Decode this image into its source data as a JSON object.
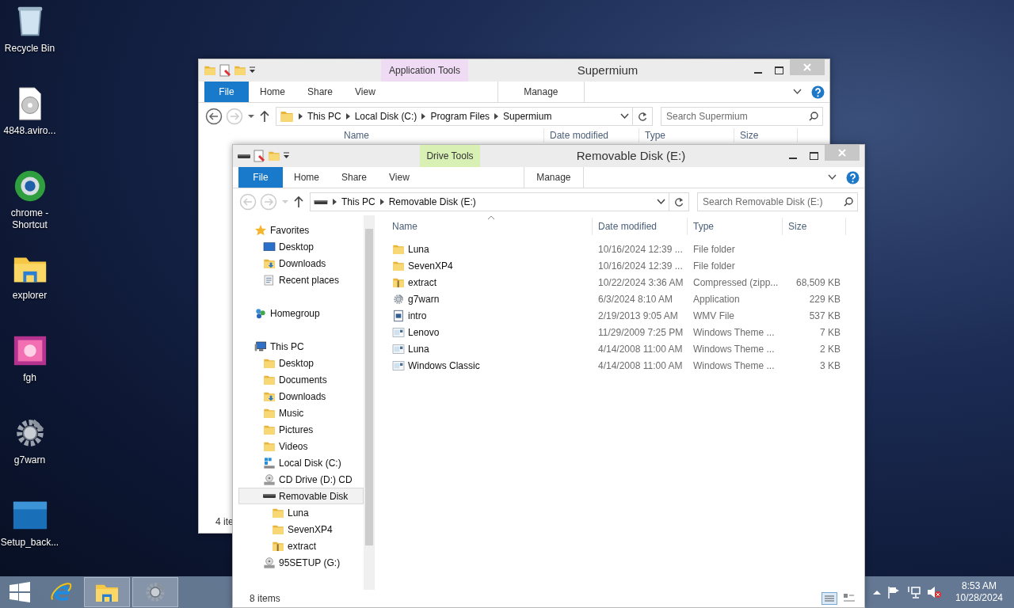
{
  "desktop_icons": [
    {
      "label": "Recycle Bin",
      "kind": "trash"
    },
    {
      "label": "4848.aviro...",
      "kind": "disc"
    },
    {
      "label": "chrome - Shortcut",
      "kind": "globe"
    },
    {
      "label": "explorer",
      "kind": "explorer"
    },
    {
      "label": "fgh",
      "kind": "picture"
    },
    {
      "label": "g7warn",
      "kind": "gear"
    },
    {
      "label": "Setup_back...",
      "kind": "tile"
    }
  ],
  "back_window": {
    "title": "Supermium",
    "context_group": {
      "label": "Application Tools",
      "color": "#efdcf4"
    },
    "ribbon_tabs": [
      {
        "label": "File",
        "kind": "file"
      },
      {
        "label": "Home",
        "kind": "tab"
      },
      {
        "label": "Share",
        "kind": "tab"
      },
      {
        "label": "View",
        "kind": "tab"
      },
      {
        "label": "Manage",
        "kind": "context"
      }
    ],
    "address_icon": {
      "kind": "folder"
    },
    "breadcrumb": [
      "This PC",
      "Local Disk (C:)",
      "Program Files",
      "Supermium"
    ],
    "search": {
      "placeholder": "Search Supermium"
    },
    "columns": [
      "Name",
      "Date modified",
      "Type",
      "Size"
    ],
    "status_text": "4 ite"
  },
  "front_window": {
    "title": "Removable Disk (E:)",
    "context_group": {
      "label": "Drive Tools",
      "color": "#d8f0b4"
    },
    "ribbon_tabs": [
      {
        "label": "File",
        "kind": "file"
      },
      {
        "label": "Home",
        "kind": "tab"
      },
      {
        "label": "Share",
        "kind": "tab"
      },
      {
        "label": "View",
        "kind": "tab"
      },
      {
        "label": "Manage",
        "kind": "context"
      }
    ],
    "address_icon": {
      "kind": "usb"
    },
    "breadcrumb": [
      "This PC",
      "Removable Disk (E:)"
    ],
    "search": {
      "placeholder": "Search Removable Disk (E:)"
    },
    "nav_tree": [
      {
        "label": "Favorites",
        "kind": "star",
        "selected": false,
        "children": [
          {
            "label": "Desktop",
            "kind": "monitor",
            "selected": false
          },
          {
            "label": "Downloads",
            "kind": "download",
            "selected": false
          },
          {
            "label": "Recent places",
            "kind": "recent",
            "selected": false
          }
        ]
      },
      {
        "label": "Homegroup",
        "kind": "homegroup",
        "selected": false
      },
      {
        "label": "This PC",
        "kind": "pc",
        "selected": false,
        "children": [
          {
            "label": "Desktop",
            "kind": "folder",
            "selected": false
          },
          {
            "label": "Documents",
            "kind": "folder",
            "selected": false
          },
          {
            "label": "Downloads",
            "kind": "download",
            "selected": false
          },
          {
            "label": "Music",
            "kind": "folder",
            "selected": false
          },
          {
            "label": "Pictures",
            "kind": "folder",
            "selected": false
          },
          {
            "label": "Videos",
            "kind": "folder",
            "selected": false
          },
          {
            "label": "Local Disk (C:)",
            "kind": "disk",
            "selected": false
          },
          {
            "label": "CD Drive (D:) CD",
            "kind": "cd",
            "selected": false
          },
          {
            "label": "Removable Disk",
            "kind": "usb",
            "selected": true,
            "children": [
              {
                "label": "Luna",
                "kind": "folder",
                "selected": false
              },
              {
                "label": "SevenXP4",
                "kind": "folder",
                "selected": false
              },
              {
                "label": "extract",
                "kind": "zip",
                "selected": false
              }
            ]
          },
          {
            "label": "95SETUP (G:)",
            "kind": "cd",
            "selected": false
          }
        ]
      }
    ],
    "columns": [
      "Name",
      "Date modified",
      "Type",
      "Size"
    ],
    "files": [
      {
        "name": "Luna",
        "kind": "folder",
        "date": "10/16/2024 12:39 ...",
        "type": "File folder",
        "selected": false
      },
      {
        "name": "SevenXP4",
        "kind": "folder",
        "date": "10/16/2024 12:39 ...",
        "type": "File folder",
        "selected": false
      },
      {
        "name": "extract",
        "kind": "zip",
        "date": "10/22/2024 3:36 AM",
        "type": "Compressed (zipp...",
        "size": "68,509 KB",
        "selected": false
      },
      {
        "name": "g7warn",
        "kind": "gear",
        "date": "6/3/2024 8:10 AM",
        "type": "Application",
        "size": "229 KB",
        "selected": false
      },
      {
        "name": "intro",
        "kind": "video",
        "date": "2/19/2013 9:05 AM",
        "type": "WMV File",
        "size": "537 KB",
        "selected": false
      },
      {
        "name": "Lenovo",
        "kind": "theme",
        "date": "11/29/2009 7:25 PM",
        "type": "Windows Theme ...",
        "size": "7 KB",
        "selected": false
      },
      {
        "name": "Luna",
        "kind": "theme",
        "date": "4/14/2008 11:00 AM",
        "type": "Windows Theme ...",
        "size": "2 KB",
        "selected": false
      },
      {
        "name": "Windows Classic",
        "kind": "theme",
        "date": "4/14/2008 11:00 AM",
        "type": "Windows Theme ...",
        "size": "3 KB",
        "selected": false
      }
    ],
    "status_text": "8 items"
  },
  "taskbar": {
    "apps": [
      {
        "kind": "ie",
        "running": false
      },
      {
        "kind": "explorer",
        "running": true
      },
      {
        "kind": "gear",
        "running": true
      }
    ],
    "clock": {
      "time": "8:53 AM",
      "date": "10/28/2024"
    }
  }
}
